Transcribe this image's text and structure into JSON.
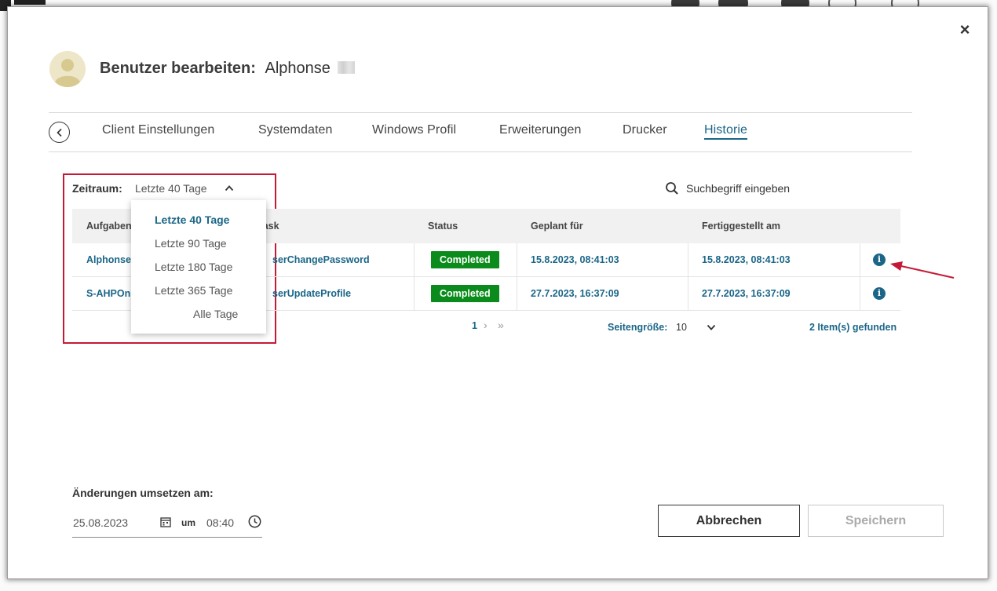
{
  "dialog": {
    "close_label": "×",
    "title_label": "Benutzer bearbeiten:",
    "user_name": "Alphonse"
  },
  "tabs": [
    {
      "label": "Client Einstellungen",
      "active": false
    },
    {
      "label": "Systemdaten",
      "active": false
    },
    {
      "label": "Windows Profil",
      "active": false
    },
    {
      "label": "Erweiterungen",
      "active": false
    },
    {
      "label": "Drucker",
      "active": false
    },
    {
      "label": "Historie",
      "active": true
    }
  ],
  "filter": {
    "label": "Zeitraum:",
    "value": "Letzte 40 Tage",
    "options": [
      "Letzte 40 Tage",
      "Letzte 90 Tage",
      "Letzte 180 Tage",
      "Letzte 365 Tage",
      "Alle Tage"
    ],
    "selected_index": 0
  },
  "search": {
    "placeholder": "Suchbegriff eingeben"
  },
  "table": {
    "columns": [
      "Aufgaben",
      "Task",
      "Status",
      "Geplant für",
      "Fertiggestellt am"
    ],
    "rows": [
      {
        "aufgabe": "Alphonse",
        "task": "serChangePassword",
        "status": "Completed",
        "geplant": "15.8.2023, 08:41:03",
        "fertig": "15.8.2023, 08:41:03"
      },
      {
        "aufgabe": "S-AHPOn",
        "task": "serUpdateProfile",
        "status": "Completed",
        "geplant": "27.7.2023, 16:37:09",
        "fertig": "27.7.2023, 16:37:09"
      }
    ]
  },
  "pagination": {
    "current_page": "1",
    "next": "›",
    "last": "»",
    "page_size_label": "Seitengröße:",
    "page_size": "10",
    "items_found": "2 Item(s) gefunden"
  },
  "changes": {
    "label": "Änderungen umsetzen am:",
    "date": "25.08.2023",
    "um_label": "um",
    "time": "08:40"
  },
  "buttons": {
    "cancel": "Abbrechen",
    "save": "Speichern"
  },
  "colors": {
    "accent": "#1b6688",
    "success": "#0b8b1c",
    "highlight_border": "#c51a37",
    "annotation_arrow": "#c51a37"
  }
}
